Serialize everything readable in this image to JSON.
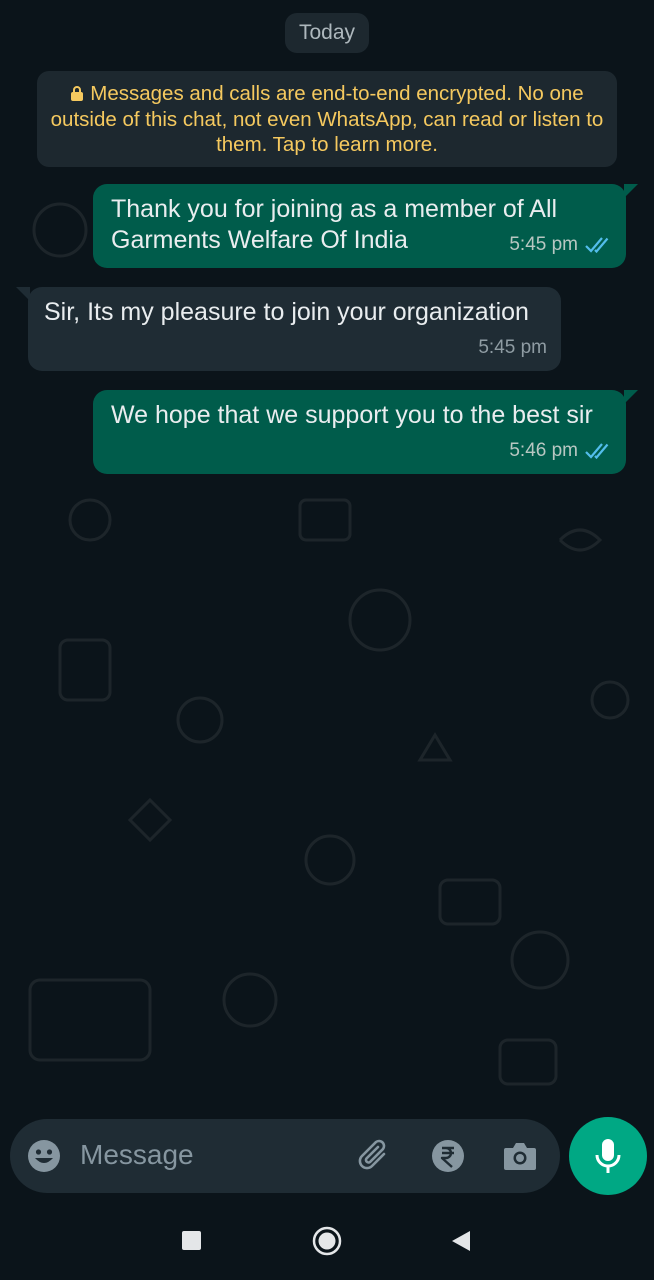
{
  "chat": {
    "date_chip": "Today",
    "encryption_notice": "Messages and calls are end-to-end encrypted. No one outside of this chat, not even WhatsApp, can read or listen to them. Tap to learn more.",
    "messages": [
      {
        "direction": "outgoing",
        "text": "Thank you for joining as a member of All Garments Welfare Of India",
        "time": "5:45 pm",
        "status": "read"
      },
      {
        "direction": "incoming",
        "text": "Sir, Its my pleasure to join your organization",
        "time": "5:45 pm"
      },
      {
        "direction": "outgoing",
        "text": "We hope that we support you to the best sir",
        "time": "5:46 pm",
        "status": "read"
      }
    ]
  },
  "composer": {
    "placeholder": "Message",
    "icons": [
      "emoji-icon",
      "attach-icon",
      "rupee-icon",
      "camera-icon",
      "mic-icon"
    ]
  },
  "navigation": {
    "icons": [
      "recent-apps-icon",
      "home-icon",
      "back-icon"
    ]
  },
  "colors": {
    "background": "#0b141a",
    "outgoing_bubble": "#005c4b",
    "incoming_bubble": "#1f2c34",
    "notice_text": "#f5c95f",
    "read_tick": "#53bdeb",
    "mic_button": "#00a884"
  }
}
